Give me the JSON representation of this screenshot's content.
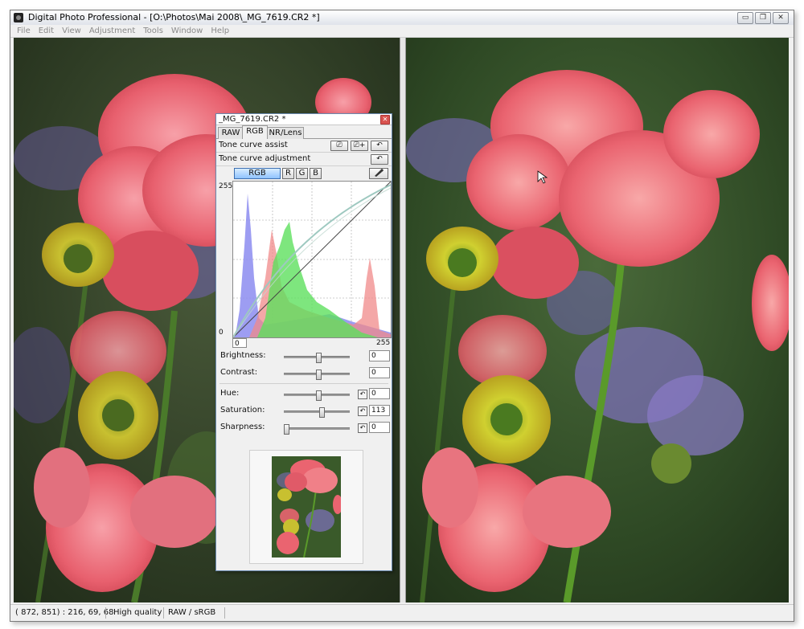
{
  "window": {
    "title": "Digital Photo Professional - [O:\\Photos\\Mai 2008\\_MG_7619.CR2 *]",
    "controls": {
      "minimize": "▭",
      "restore": "❐",
      "close": "✕"
    }
  },
  "menu": [
    "File",
    "Edit",
    "View",
    "Adjustment",
    "Tools",
    "Window",
    "Help"
  ],
  "palette": {
    "title": "_MG_7619.CR2 *",
    "close": "✕",
    "tabs": [
      "RAW",
      "RGB",
      "NR/Lens"
    ],
    "active_tab": "RGB",
    "tone_curve_assist": {
      "label": "Tone curve assist",
      "buttons": [
        "⎚",
        "⎚+",
        "↶"
      ]
    },
    "tone_curve_adjustment": {
      "label": "Tone curve adjustment",
      "reset": "↶"
    },
    "channels": [
      "RGB",
      "R",
      "G",
      "B"
    ],
    "active_channel": "RGB",
    "eyedropper_icon": "eyedropper-icon",
    "curve": {
      "y_max_label": "255",
      "y_min_label": "0",
      "x_input_value": "0",
      "x_max_label": "255"
    },
    "sliders": [
      {
        "label": "Brightness:",
        "value": "0",
        "fraction": 0.52,
        "has_reset": false
      },
      {
        "label": "Contrast:",
        "value": "0",
        "fraction": 0.52,
        "has_reset": false
      }
    ],
    "sliders2": [
      {
        "label": "Hue:",
        "value": "0",
        "fraction": 0.52,
        "has_reset": true
      },
      {
        "label": "Saturation:",
        "value": "113",
        "fraction": 0.58,
        "has_reset": true
      },
      {
        "label": "Sharpness:",
        "value": "0",
        "fraction": 0.0,
        "has_reset": true
      }
    ],
    "reset_glyph": "↶"
  },
  "status": {
    "coords": "( 872, 851) : 216, 69, 68",
    "quality": "High quality",
    "color_space": "RAW / sRGB"
  },
  "colors": {
    "accent": "#3c6eb0",
    "hist_red": "#f08080",
    "hist_green": "#5ee05e",
    "hist_blue": "#8080f0"
  }
}
